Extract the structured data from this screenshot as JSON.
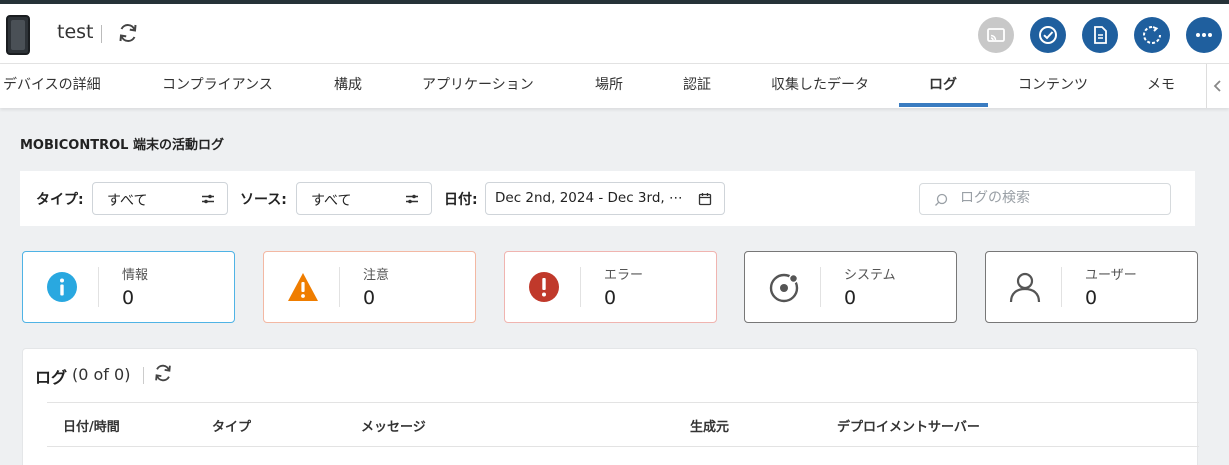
{
  "header": {
    "device_name": "test"
  },
  "tabs": [
    {
      "label": "デバイスの詳細"
    },
    {
      "label": "コンプライアンス"
    },
    {
      "label": "構成"
    },
    {
      "label": "アプリケーション"
    },
    {
      "label": "場所"
    },
    {
      "label": "認証"
    },
    {
      "label": "収集したデータ"
    },
    {
      "label": "ログ",
      "active": true
    },
    {
      "label": "コンテンツ"
    },
    {
      "label": "メモ"
    }
  ],
  "section_title": "MOBICONTROL 端末の活動ログ",
  "filters": {
    "type_label": "タイプ:",
    "type_value": "すべて",
    "source_label": "ソース:",
    "source_value": "すべて",
    "date_label": "日付:",
    "date_value": "Dec 2nd, 2024 - Dec 3rd, ⋯",
    "search_placeholder": "ログの検索"
  },
  "summary_cards": [
    {
      "label": "情報",
      "value": "0",
      "icon": "info-icon",
      "color": "#29a8e0"
    },
    {
      "label": "注意",
      "value": "0",
      "icon": "warning-icon",
      "color": "#ef7d00"
    },
    {
      "label": "エラー",
      "value": "0",
      "icon": "error-icon",
      "color": "#c0392b"
    },
    {
      "label": "システム",
      "value": "0",
      "icon": "system-icon",
      "color": "#555555"
    },
    {
      "label": "ユーザー",
      "value": "0",
      "icon": "user-icon",
      "color": "#555555"
    }
  ],
  "log_table": {
    "title": "ログ",
    "count": "(0 of 0)",
    "columns": [
      "日付/時間",
      "タイプ",
      "メッセージ",
      "生成元",
      "デプロイメントサーバー"
    ]
  },
  "colors": {
    "accent": "#1f5f9e",
    "tab_underline": "#3a7cc1",
    "disabled": "#c8c8c8"
  }
}
